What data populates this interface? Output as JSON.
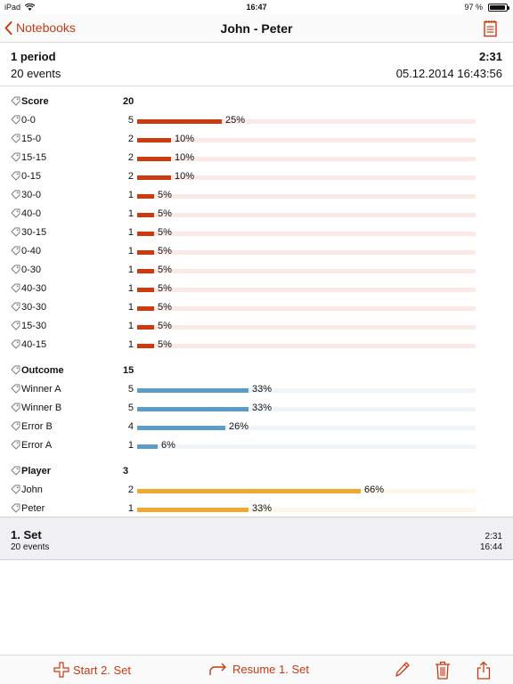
{
  "status_bar": {
    "device": "iPad",
    "time": "16:47",
    "battery": "97 %"
  },
  "nav": {
    "back_label": "Notebooks",
    "title": "John - Peter"
  },
  "summary": {
    "period": "1 period",
    "duration": "2:31",
    "events": "20 events",
    "date": "05.12.2014 16:43:56"
  },
  "colors": {
    "accent": "#c83a12",
    "score": "#cc3a10",
    "score_track": "#fbe9e5",
    "outcome": "#5b9cc9",
    "outcome_track": "#eef4f9",
    "player": "#f0a830",
    "player_track": "#fdf6e9"
  },
  "groups": [
    {
      "label": "Score",
      "count": "20",
      "color": "score",
      "items": [
        {
          "label": "0-0",
          "value": "5",
          "pct": "25%",
          "fraction": 0.25
        },
        {
          "label": "15-0",
          "value": "2",
          "pct": "10%",
          "fraction": 0.1
        },
        {
          "label": "15-15",
          "value": "2",
          "pct": "10%",
          "fraction": 0.1
        },
        {
          "label": "0-15",
          "value": "2",
          "pct": "10%",
          "fraction": 0.1
        },
        {
          "label": "30-0",
          "value": "1",
          "pct": "5%",
          "fraction": 0.05
        },
        {
          "label": "40-0",
          "value": "1",
          "pct": "5%",
          "fraction": 0.05
        },
        {
          "label": "30-15",
          "value": "1",
          "pct": "5%",
          "fraction": 0.05
        },
        {
          "label": "0-40",
          "value": "1",
          "pct": "5%",
          "fraction": 0.05
        },
        {
          "label": "0-30",
          "value": "1",
          "pct": "5%",
          "fraction": 0.05
        },
        {
          "label": "40-30",
          "value": "1",
          "pct": "5%",
          "fraction": 0.05
        },
        {
          "label": "30-30",
          "value": "1",
          "pct": "5%",
          "fraction": 0.05
        },
        {
          "label": "15-30",
          "value": "1",
          "pct": "5%",
          "fraction": 0.05
        },
        {
          "label": "40-15",
          "value": "1",
          "pct": "5%",
          "fraction": 0.05
        }
      ]
    },
    {
      "label": "Outcome",
      "count": "15",
      "color": "outcome",
      "items": [
        {
          "label": "Winner A",
          "value": "5",
          "pct": "33%",
          "fraction": 0.33
        },
        {
          "label": "Winner B",
          "value": "5",
          "pct": "33%",
          "fraction": 0.33
        },
        {
          "label": "Error B",
          "value": "4",
          "pct": "26%",
          "fraction": 0.26
        },
        {
          "label": "Error A",
          "value": "1",
          "pct": "6%",
          "fraction": 0.06
        }
      ]
    },
    {
      "label": "Player",
      "count": "3",
      "color": "player",
      "items": [
        {
          "label": "John",
          "value": "2",
          "pct": "66%",
          "fraction": 0.66
        },
        {
          "label": "Peter",
          "value": "1",
          "pct": "33%",
          "fraction": 0.33
        }
      ]
    }
  ],
  "set": {
    "title": "1. Set",
    "events": "20 events",
    "duration": "2:31",
    "time": "16:44"
  },
  "toolbar": {
    "start_label": "Start 2. Set",
    "resume_label": "Resume 1. Set"
  },
  "icons": {
    "back": "chevron-left-icon",
    "notes": "notepad-icon",
    "tag": "tag-icon",
    "plus": "plus-icon",
    "resume": "curved-arrow-icon",
    "edit": "pencil-icon",
    "delete": "trash-icon",
    "share": "share-icon"
  }
}
